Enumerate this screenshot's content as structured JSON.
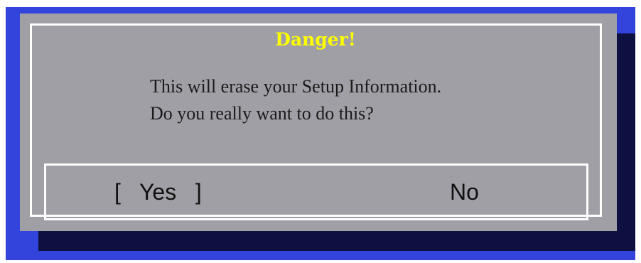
{
  "dialog": {
    "title": "Danger!",
    "message_lines": [
      "This will erase your Setup Information.",
      "Do you really want to do this?"
    ],
    "buttons": {
      "yes_open_bracket": "[",
      "yes_label": "Yes",
      "yes_close_bracket": "]",
      "no_label": "No"
    },
    "selected_button": "Yes"
  },
  "colors": {
    "screen_background": "#3344dd",
    "dialog_background": "#a09fa6",
    "shadow": "#0d1040",
    "title_text": "#ffff00",
    "border": "#ffffff"
  }
}
